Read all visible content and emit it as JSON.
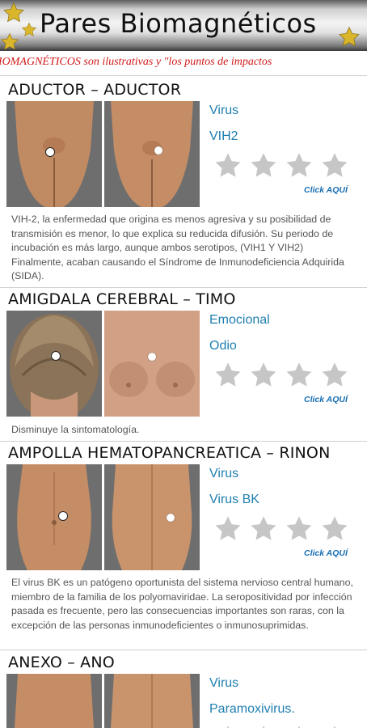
{
  "header": {
    "title": "Pares Biomagnéticos"
  },
  "marquee": {
    "text": "IOMAGNÉTICOS son ilustrativas y \"los puntos de impactos"
  },
  "cards": [
    {
      "title": "ADUCTOR – ADUCTOR",
      "tag1": "Virus",
      "tag2": "VIH2",
      "rating": 0,
      "click_label": "Click AQUÍ",
      "description": "VIH-2, la enfermedad que origina es menos agresiva y su posibilidad de transmisión es menor, lo que explica su reducida difusión. Su periodo de incubación es más largo, aunque ambos serotipos, (VIH1 Y VIH2) Finalmente, acaban causando el Síndrome de Inmunodeficiencia Adquirida (SIDA)."
    },
    {
      "title": "AMIGDALA CEREBRAL – TIMO",
      "tag1": "Emocional",
      "tag2": "Odio",
      "rating": 0,
      "click_label": "Click AQUÍ",
      "description": "Disminuye la sintomatología."
    },
    {
      "title": "AMPOLLA HEMATOPANCREATICA – RINON",
      "tag1": "Virus",
      "tag2": "Virus BK",
      "rating": 0,
      "click_label": "Click AQUÍ",
      "description": "El virus BK es un patógeno oportunista del sistema nervioso central humano, miembro de la familia de los polyomaviridae. La seropositividad por infección pasada es frecuente, pero las consecuencias importantes son raras, con la excepción de las personas inmunodeficientes o inmunosuprimidas."
    },
    {
      "title": "ANEXO – ANO",
      "tag1": "Virus",
      "tag2": "Paramoxivirus."
    }
  ],
  "icons": {
    "rating_star": "star-icon",
    "header_star": "gold-star-icon",
    "body_point": "impact-point-icon"
  },
  "colors": {
    "link_blue": "#1f7fb0",
    "marquee_red": "#d01818",
    "star_grey": "#c6c6c6",
    "star_gold": "#d9b62b"
  }
}
